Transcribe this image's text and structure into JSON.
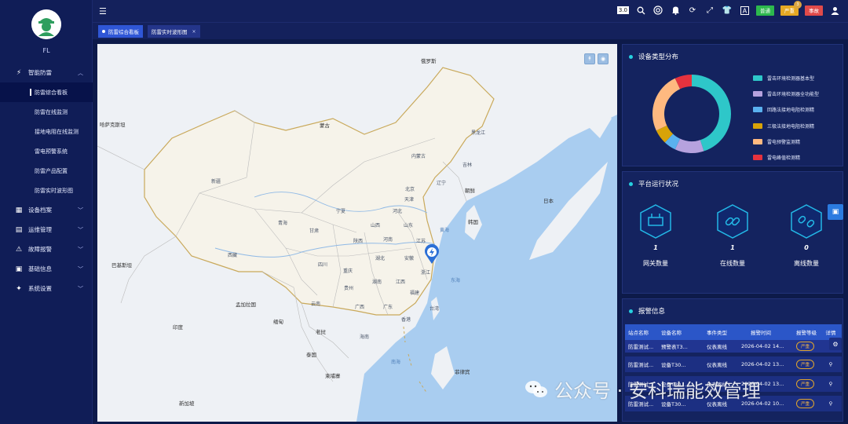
{
  "user": {
    "name": "FL"
  },
  "sidebar": {
    "groups": [
      {
        "label": "智能防雷",
        "icon": "lightning-icon",
        "expanded": true,
        "children": [
          "防雷综合看板",
          "防雷在线监测",
          "接地电阻在线监测",
          "雷电预警系统",
          "防雷产品配置",
          "防雷实时波形图"
        ]
      },
      {
        "label": "设备档案",
        "icon": "archive-icon"
      },
      {
        "label": "运维管理",
        "icon": "maintenance-icon"
      },
      {
        "label": "故障报警",
        "icon": "alarm-icon"
      },
      {
        "label": "基础信息",
        "icon": "info-icon"
      },
      {
        "label": "系统设置",
        "icon": "settings-icon"
      }
    ]
  },
  "topbar": {
    "version": "3.0",
    "badges": [
      {
        "label": "普通",
        "color": "#2db84d"
      },
      {
        "label": "严重",
        "color": "#e5a823",
        "count": "3"
      },
      {
        "label": "事故",
        "color": "#e04a4a"
      }
    ]
  },
  "tabs": [
    {
      "label": "防雷综合看板",
      "active": true
    },
    {
      "label": "防雷实时波形图",
      "active": false
    }
  ],
  "map": {
    "labels": {
      "countries": [
        "蒙古",
        "俄罗斯",
        "哈萨克斯坦",
        "朝鲜",
        "韩国",
        "日本",
        "印度",
        "巴基斯坦",
        "孟加拉国",
        "缅甸",
        "泰国",
        "老挝",
        "柬埔寨",
        "新加坡",
        "菲律宾"
      ],
      "provinces": [
        "新疆",
        "西藏",
        "青海",
        "甘肃",
        "内蒙古",
        "黑龙江",
        "吉林",
        "辽宁",
        "北京",
        "天津",
        "河北",
        "山西",
        "山东",
        "河南",
        "陕西",
        "宁夏",
        "四川",
        "重庆",
        "湖北",
        "安徽",
        "江苏",
        "上海",
        "浙江",
        "江西",
        "湖南",
        "贵州",
        "云南",
        "广西",
        "广东",
        "福建",
        "台湾",
        "海南",
        "香港"
      ],
      "seas": [
        "黄海",
        "东海",
        "南海"
      ]
    }
  },
  "device_type": {
    "title": "设备类型分布",
    "legend": [
      {
        "label": "雷击环境检测器基本型",
        "color": "#2ec7c9"
      },
      {
        "label": "雷击环境检测器全功能型",
        "color": "#b6a2de"
      },
      {
        "label": "回路法接地电阻检测精",
        "color": "#5ab1ef"
      },
      {
        "label": "三极法接地电阻检测精",
        "color": "#d8a308"
      },
      {
        "label": "雷电预警监测精",
        "color": "#ffb980"
      },
      {
        "label": "雷电峰值检测精",
        "color": "#e5323e"
      }
    ],
    "chart_data": {
      "type": "pie",
      "categories": [
        "雷击环境检测器基本型",
        "雷击环境检测器全功能型",
        "回路法接地电阻检测精",
        "三极法接地电阻检测精",
        "雷电预警监测精",
        "雷电峰值检测精"
      ],
      "values": [
        45,
        12,
        5,
        6,
        25,
        7
      ]
    }
  },
  "platform": {
    "title": "平台运行状况",
    "stats": [
      {
        "label": "网关数量",
        "value": "1",
        "icon": "gateway-icon"
      },
      {
        "label": "在线数量",
        "value": "1",
        "icon": "link-icon"
      },
      {
        "label": "离线数量",
        "value": "0",
        "icon": "unlink-icon"
      }
    ]
  },
  "alarms": {
    "title": "报警信息",
    "columns": [
      "站点名称",
      "设备名称",
      "事件类型",
      "报警时间",
      "报警等级",
      "详情"
    ],
    "rows": [
      {
        "site": "防雷测试...",
        "device": "预警表T3...",
        "event": "仪表离线",
        "time": "2026-04-02 14...",
        "level": "严重"
      },
      {
        "site": "防雷测试...",
        "device": "设备T30...",
        "event": "仪表离线",
        "time": "2026-04-02 13...",
        "level": "严重"
      },
      {
        "site": "防雷测试...",
        "device": "设备T30...",
        "event": "仪表离线",
        "time": "2026-04-02 13...",
        "level": "严重"
      },
      {
        "site": "防雷测试...",
        "device": "设备T30...",
        "event": "仪表离线",
        "time": "2026-04-02 10...",
        "level": "严重"
      }
    ]
  },
  "watermark": {
    "text": "公众号 · 安科瑞能效管理"
  }
}
